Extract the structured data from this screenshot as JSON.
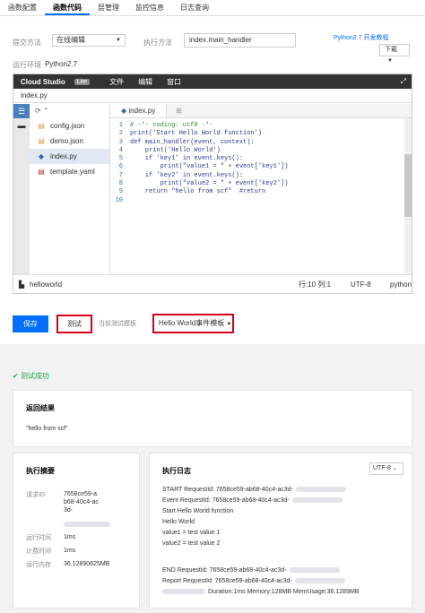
{
  "tabs": [
    "函数配置",
    "函数代码",
    "层管理",
    "监控信息",
    "日志查询"
  ],
  "form": {
    "submit_label": "提交方法",
    "submit_value": "在线编辑",
    "exec_label": "执行方法",
    "exec_value": "index.main_handler",
    "link": "Python2.7 开发教程",
    "download": "下载",
    "env_label": "运行环境",
    "env_value": "Python2.7"
  },
  "ide": {
    "brand": "Cloud Studio",
    "lite": "Lite",
    "menus": [
      "文件",
      "编辑",
      "窗口"
    ],
    "file_title": "index.py",
    "files": [
      "config.json",
      "demo.json",
      "index.py",
      "template.yaml"
    ],
    "active_tab": "index.py",
    "code": [
      {
        "n": "1",
        "t": "# -*- coding: utf8 -*-",
        "c": true
      },
      {
        "n": "2",
        "t": "print('Start Hello World function')",
        "c": false
      },
      {
        "n": "3",
        "t": "def main_handler(event, context):",
        "c": false
      },
      {
        "n": "4",
        "t": "    print('Hello World')",
        "c": false
      },
      {
        "n": "5",
        "t": "    if 'key1' in event.keys():",
        "c": false
      },
      {
        "n": "6",
        "t": "        print(\"value1 = \" + event['key1'])",
        "c": false
      },
      {
        "n": "7",
        "t": "    if 'key2' in event.keys():",
        "c": false
      },
      {
        "n": "8",
        "t": "        print(\"value2 = \" + event['key2'])",
        "c": false
      },
      {
        "n": "9",
        "t": "    return \"hello from scf\"  #return",
        "c": false
      },
      {
        "n": "10",
        "t": "",
        "c": false
      }
    ],
    "status_func": "helloworld",
    "status_pos": "行:10 列:1",
    "status_enc": "UTF-8",
    "status_lang": "python"
  },
  "actions": {
    "save": "保存",
    "test": "测试",
    "tpl_label": "当前测试模板",
    "tpl_value": "Hello World事件模板"
  },
  "result": {
    "ok": "测试成功",
    "return_title": "返回结果",
    "return_value": "\"hello from scf\"",
    "summary_title": "执行摘要",
    "req_label": "请求ID",
    "req_value": "7658ce59-ab68-40c4-ac3d-",
    "runtime_label": "运行时间",
    "runtime_value": "1ms",
    "billed_label": "计费时间",
    "billed_value": "1ms",
    "mem_label": "运行内存",
    "mem_value": "36.12890625MB",
    "log_title": "执行日志",
    "log_enc": "UTF-8",
    "logs": [
      "START RequestId: 7658ce59-ab68-40c4-ac3d-",
      "Event RequestId: 7658ce59-ab68-40c4-ac3d-",
      "Start Hello World function",
      "Hello World",
      "value1 = test value 1",
      "value2 = test value 2",
      "",
      "END RequestId: 7658ce59-ab68-40c4-ac3d-",
      "Report RequestId: 7658ce59-ab68-40c4-ac3d-"
    ],
    "log_tail": "Duration:1ms Memory:128MB MemUsage:36.1289MB"
  }
}
